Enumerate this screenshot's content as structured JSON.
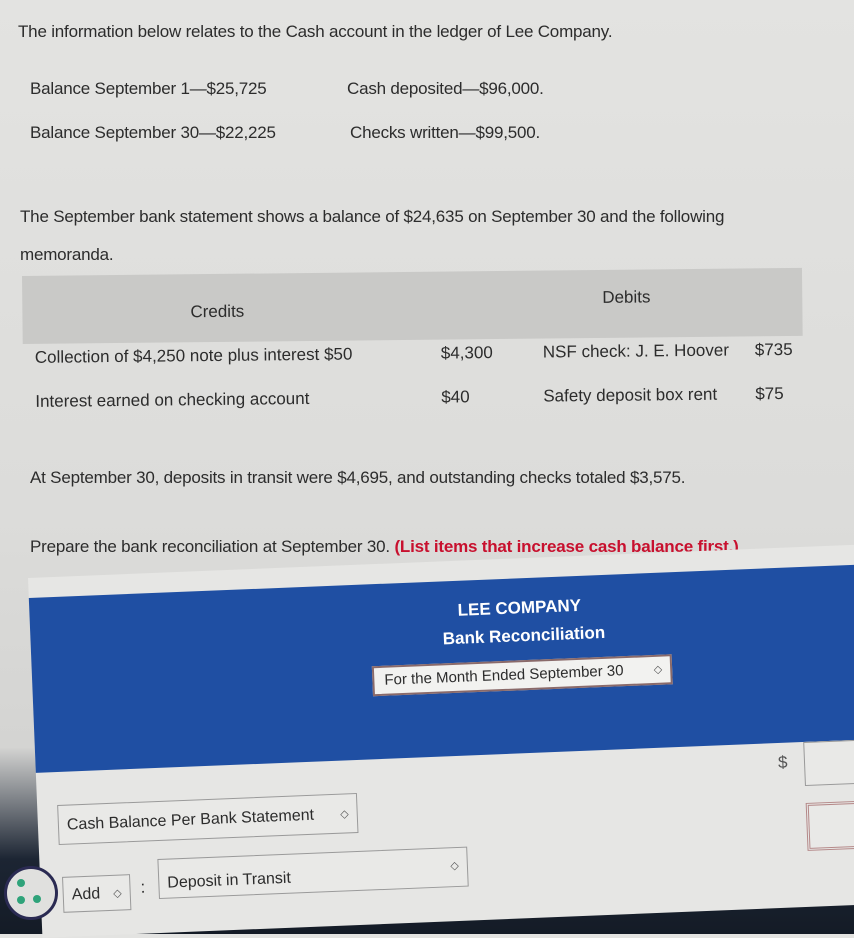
{
  "problem": {
    "intro": "The information below relates to the Cash account in the ledger of Lee Company.",
    "facts": {
      "balance_sep1": "Balance September 1—$25,725",
      "cash_deposited": "Cash deposited—$96,000.",
      "balance_sep30": "Balance September 30—$22,225",
      "checks_written": "Checks written—$99,500."
    },
    "statement_line1": "The September bank statement shows a balance of $24,635 on September 30 and the following",
    "statement_line2": "memoranda.",
    "memoranda": {
      "headers": {
        "credits": "Credits",
        "debits": "Debits"
      },
      "rows": [
        {
          "credit_desc": "Collection of $4,250 note plus interest $50",
          "credit_amount": "$4,300",
          "debit_desc": "NSF check: J. E. Hoover",
          "debit_amount": "$735"
        },
        {
          "credit_desc": "Interest earned on checking account",
          "credit_amount": "$40",
          "debit_desc": "Safety deposit box rent",
          "debit_amount": "$75"
        }
      ]
    },
    "transit_text": "At September 30, deposits in transit were $4,695, and outstanding checks totaled $3,575.",
    "prepare_text": "Prepare the bank reconciliation at September 30.",
    "prepare_highlight": "(List items that increase cash balance first.)"
  },
  "form": {
    "company": "LEE COMPANY",
    "report_title": "Bank Reconciliation",
    "period_select": "For the Month Ended September 30",
    "currency_symbol": "$",
    "bank_balance_select": "Cash Balance Per Bank Statement",
    "adjust_select": "Add",
    "colon": ":",
    "item_select": "Deposit in Transit",
    "amount_1": "",
    "amount_2": ""
  },
  "colors": {
    "header_blue": "#1f4fa3",
    "highlight_red": "#c8102e",
    "icon_green": "#2fa37a"
  },
  "icons": {
    "select_chevron": "updown-chevron-icon",
    "bottom_app": "cookie-icon"
  }
}
